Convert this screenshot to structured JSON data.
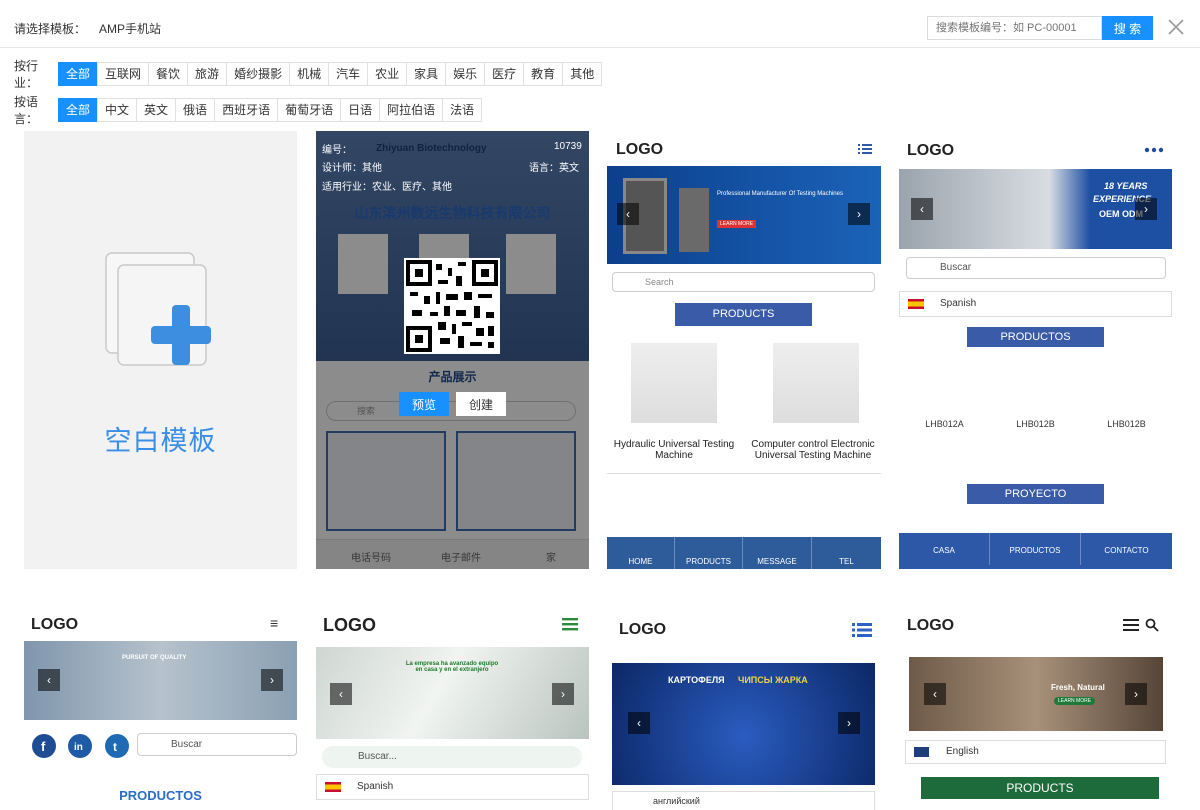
{
  "top": {
    "label": "请选择模板：",
    "tab": "AMP手机站",
    "search_placeholder": "搜索模板编号：如 PC-00001",
    "search_btn": "搜 索"
  },
  "industry": {
    "label": "按行业：",
    "items": [
      "全部",
      "互联网",
      "餐饮",
      "旅游",
      "婚纱摄影",
      "机械",
      "汽车",
      "农业",
      "家具",
      "娱乐",
      "医疗",
      "教育",
      "其他"
    ]
  },
  "language": {
    "label": "按语言：",
    "items": [
      "全部",
      "中文",
      "英文",
      "俄语",
      "西班牙语",
      "葡萄牙语",
      "日语",
      "阿拉伯语",
      "法语"
    ]
  },
  "blank": {
    "title": "空白模板"
  },
  "c2": {
    "num_label": "编号：",
    "num": "10739",
    "designer": "设计师：其他",
    "lang": "语言：英文",
    "industry": "适用行业：农业、医疗、其他",
    "company": "山东滨州数远生物科技有限公司",
    "brand": "Zhiyuan Biotechnology",
    "section": "产品展示",
    "search": "搜索",
    "preview": "预览",
    "create": "创建",
    "b1": "电话号码",
    "b2": "电子邮件",
    "b3": "家"
  },
  "c3": {
    "logo": "LOGO",
    "banner": "Professional Manufacturer Of Testing Machines",
    "learn": "LEARN MORE",
    "search": "Search",
    "products": "PRODUCTS",
    "p1": "Hydraulic Universal Testing Machine",
    "p2": "Computer control Electronic Universal Testing Machine",
    "nav": [
      "HOME",
      "PRODUCTS",
      "MESSAGE",
      "TEL"
    ]
  },
  "c4": {
    "logo": "LOGO",
    "banner1": "18 YEARS",
    "banner2": "EXPERIENCE",
    "banner3": "OEM ODM",
    "search": "Buscar",
    "lang": "Spanish",
    "products": "PRODUCTOS",
    "p": [
      "LHB012A",
      "LHB012B",
      "LHB012B"
    ],
    "proyecto": "PROYECTO",
    "nav": [
      "CASA",
      "PRODUCTOS",
      "CONTACTO"
    ]
  },
  "c5": {
    "logo": "LOGO",
    "banner": "PURSUIT OF QUALITY",
    "search": "Buscar",
    "products": "PRODUCTOS"
  },
  "c6": {
    "logo": "LOGO",
    "banner": "La empresa ha avanzado equipo en casa y en el extranjero",
    "search": "Buscar...",
    "lang": "Spanish"
  },
  "c7": {
    "logo": "LOGO",
    "banner1": "КАРТОФЕЛЯ",
    "banner2": "ЧИПСЫ ЖАРКА",
    "lang": "английский"
  },
  "c8": {
    "logo": "LOGO",
    "banner1": "Fresh, Natural",
    "learn": "LEARN MORE",
    "lang": "English",
    "products": "PRODUCTS"
  }
}
